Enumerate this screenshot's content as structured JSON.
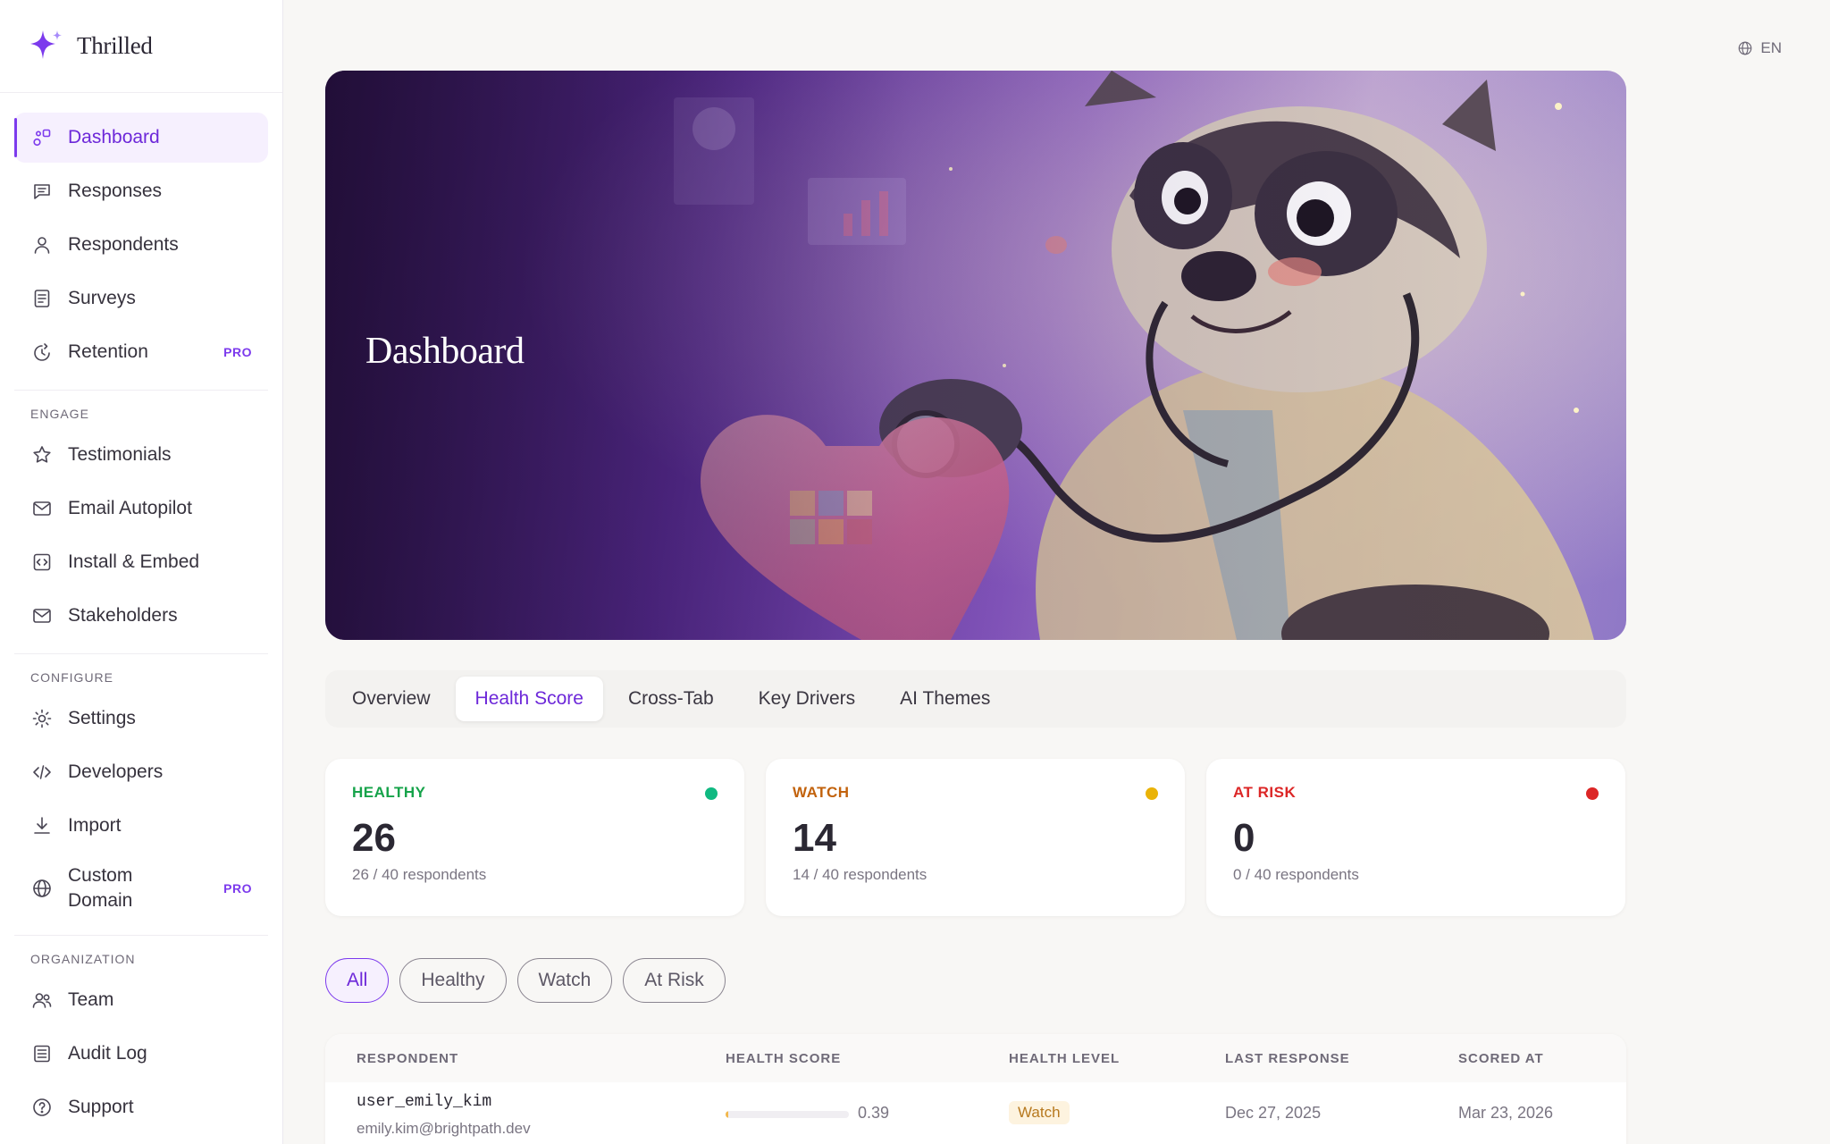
{
  "brand": {
    "name": "Thrilled"
  },
  "lang": {
    "code": "EN"
  },
  "sidebar": {
    "main": [
      {
        "label": "Dashboard",
        "icon": "dashboard-icon"
      },
      {
        "label": "Responses",
        "icon": "chat-icon"
      },
      {
        "label": "Respondents",
        "icon": "user-icon"
      },
      {
        "label": "Surveys",
        "icon": "document-icon"
      },
      {
        "label": "Retention",
        "icon": "retention-icon",
        "badge": "PRO"
      }
    ],
    "engage_label": "ENGAGE",
    "engage": [
      {
        "label": "Testimonials",
        "icon": "star-icon"
      },
      {
        "label": "Email Autopilot",
        "icon": "mail-icon"
      },
      {
        "label": "Install & Embed",
        "icon": "code-box-icon"
      },
      {
        "label": "Stakeholders",
        "icon": "mail-icon"
      }
    ],
    "configure_label": "CONFIGURE",
    "configure": [
      {
        "label": "Settings",
        "icon": "gear-icon"
      },
      {
        "label": "Developers",
        "icon": "code-icon"
      },
      {
        "label": "Import",
        "icon": "download-icon"
      },
      {
        "label": "Custom Domain",
        "icon": "globe-icon",
        "badge": "PRO"
      }
    ],
    "organization_label": "ORGANIZATION",
    "organization": [
      {
        "label": "Team",
        "icon": "team-icon"
      },
      {
        "label": "Audit Log",
        "icon": "log-icon"
      },
      {
        "label": "Support",
        "icon": "help-icon"
      }
    ]
  },
  "hero": {
    "title": "Dashboard"
  },
  "tabs": [
    {
      "label": "Overview"
    },
    {
      "label": "Health Score"
    },
    {
      "label": "Cross-Tab"
    },
    {
      "label": "Key Drivers"
    },
    {
      "label": "AI Themes"
    }
  ],
  "active_tab": "Health Score",
  "cards": [
    {
      "label": "HEALTHY",
      "value": "26",
      "sub": "26 / 40 respondents",
      "color": "#16a34a",
      "dot": "#10b981"
    },
    {
      "label": "WATCH",
      "value": "14",
      "sub": "14 / 40 respondents",
      "color": "#c2620c",
      "dot": "#eab308"
    },
    {
      "label": "AT RISK",
      "value": "0",
      "sub": "0 / 40 respondents",
      "color": "#dc2626",
      "dot": "#dc2626"
    }
  ],
  "filters": [
    {
      "label": "All"
    },
    {
      "label": "Healthy"
    },
    {
      "label": "Watch"
    },
    {
      "label": "At Risk"
    }
  ],
  "active_filter": "All",
  "table": {
    "headers": [
      "RESPONDENT",
      "HEALTH SCORE",
      "HEALTH LEVEL",
      "LAST RESPONSE",
      "SCORED AT"
    ],
    "rows": [
      {
        "user": "user_emily_kim",
        "email": "emily.kim@brightpath.dev",
        "score": 0.39,
        "score_label": "0.39",
        "level": "Watch",
        "last_response": "Dec 27, 2025",
        "scored_at": "Mar 23, 2026"
      }
    ]
  },
  "colors": {
    "accent": "#7c3aed",
    "accent_bg": "#f6f0fe"
  }
}
